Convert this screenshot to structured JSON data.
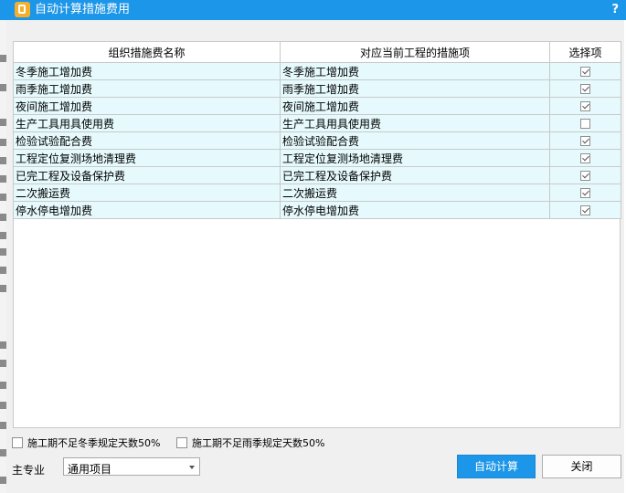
{
  "window": {
    "title": "自动计算措施费用",
    "help_label": "?"
  },
  "table": {
    "headers": [
      "组织措施费名称",
      "对应当前工程的措施项",
      "选择项"
    ],
    "rows": [
      {
        "name": "冬季施工增加费",
        "item": "冬季施工增加费",
        "selected": true
      },
      {
        "name": "雨季施工增加费",
        "item": "雨季施工增加费",
        "selected": true
      },
      {
        "name": "夜间施工增加费",
        "item": "夜间施工增加费",
        "selected": true
      },
      {
        "name": "生产工具用具使用费",
        "item": "生产工具用具使用费",
        "selected": false
      },
      {
        "name": "检验试验配合费",
        "item": "检验试验配合费",
        "selected": true
      },
      {
        "name": "工程定位复测场地清理费",
        "item": "工程定位复测场地清理费",
        "selected": true
      },
      {
        "name": "已完工程及设备保护费",
        "item": "已完工程及设备保护费",
        "selected": true
      },
      {
        "name": "二次搬运费",
        "item": "二次搬运费",
        "selected": true
      },
      {
        "name": "停水停电增加费",
        "item": "停水停电增加费",
        "selected": true
      }
    ]
  },
  "options": {
    "winter_short": {
      "label": "施工期不足冬季规定天数50%",
      "checked": false
    },
    "rainy_short": {
      "label": "施工期不足雨季规定天数50%",
      "checked": false
    }
  },
  "main_specialty": {
    "label": "主专业",
    "value": "通用项目"
  },
  "buttons": {
    "auto_calc": "自动计算",
    "close": "关闭"
  },
  "colors": {
    "titlebar": "#1c96e8",
    "row_bg": "#e6fafd",
    "dialog_bg": "#f0f0f0"
  }
}
